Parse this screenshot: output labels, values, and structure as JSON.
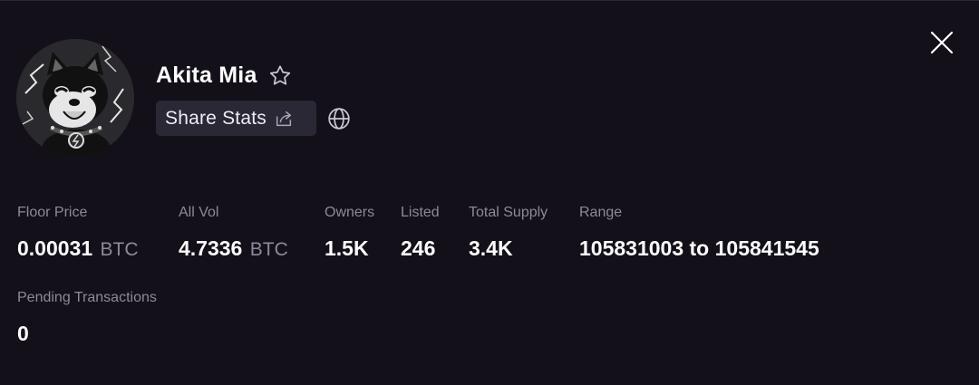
{
  "collection": {
    "name": "Akita Mia",
    "share_label": "Share Stats"
  },
  "icons": {
    "favorite": "star-outline-icon",
    "share": "share-icon",
    "website": "globe-icon",
    "close": "close-icon"
  },
  "stats": {
    "floor_price": {
      "label": "Floor Price",
      "value": "0.00031",
      "unit": "BTC"
    },
    "all_vol": {
      "label": "All Vol",
      "value": "4.7336",
      "unit": "BTC"
    },
    "owners": {
      "label": "Owners",
      "value": "1.5K"
    },
    "listed": {
      "label": "Listed",
      "value": "246"
    },
    "total_supply": {
      "label": "Total Supply",
      "value": "3.4K"
    },
    "range": {
      "label": "Range",
      "value": "105831003 to 105841545"
    },
    "pending": {
      "label": "Pending Transactions",
      "value": "0"
    }
  },
  "colors": {
    "background": "#131019",
    "button_bg": "#2b2836",
    "muted_text": "#8d8a99",
    "text": "#ffffff"
  }
}
